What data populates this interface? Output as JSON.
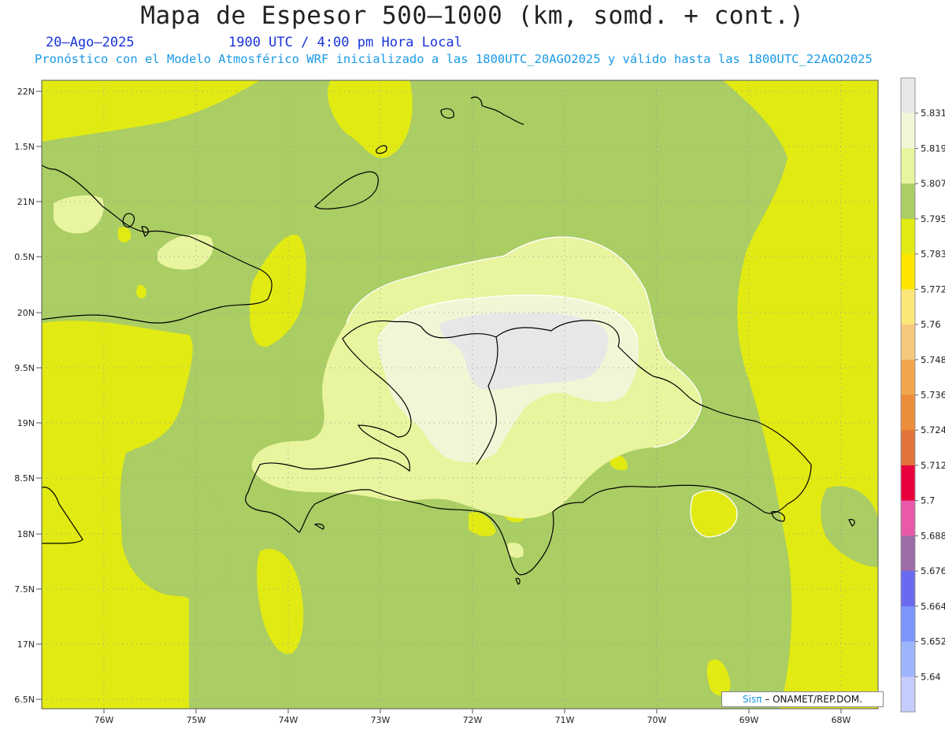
{
  "header": {
    "title": "Mapa de Espesor 500–1000 (km, somd. + cont.)",
    "date": "20–Ago–2025",
    "time": "1900 UTC / 4:00 pm Hora Local",
    "forecast": "Pronóstico con el Modelo Atmosférico WRF inicializado a las 1800UTC_20AGO2025 y válido hasta las  1800UTC_22AGO2025"
  },
  "map": {
    "lat_labels": [
      "22N",
      "1.5N",
      "21N",
      "0.5N",
      "20N",
      "9.5N",
      "19N",
      "8.5N",
      "18N",
      "7.5N",
      "17N",
      "6.5N"
    ],
    "lon_labels": [
      "76W",
      "75W",
      "74W",
      "73W",
      "72W",
      "71W",
      "70W",
      "69W",
      "68W"
    ],
    "colors": {
      "ocean": "#aacd64",
      "yellow": "#e2ea13",
      "light1": "#e8f49e",
      "light2": "#f0f7d6",
      "light3": "#e7e7e7",
      "coast": "#000000",
      "grid": "#999999"
    }
  },
  "legend": {
    "labels": [
      "5.831",
      "5.819",
      "5.807",
      "5.795",
      "5.783",
      "5.772",
      "5.76",
      "5.748",
      "5.736",
      "5.724",
      "5.712",
      "5.7",
      "5.688",
      "5.676",
      "5.664",
      "5.652",
      "5.64"
    ],
    "colors": [
      "#e7e7e7",
      "#f0f7d6",
      "#e8f49e",
      "#aacd64",
      "#e2ea13",
      "#fde500",
      "#fbe678",
      "#f3c87f",
      "#f0a64a",
      "#ec8d3a",
      "#e0743a",
      "#e8003c",
      "#e85aa8",
      "#9b6ca8",
      "#6a6af0",
      "#7a96fc",
      "#9cb4fc",
      "#c3ccfc"
    ]
  },
  "credit": {
    "sis": "Sisπ",
    "org": "– ONAMET/REP.DOM."
  }
}
